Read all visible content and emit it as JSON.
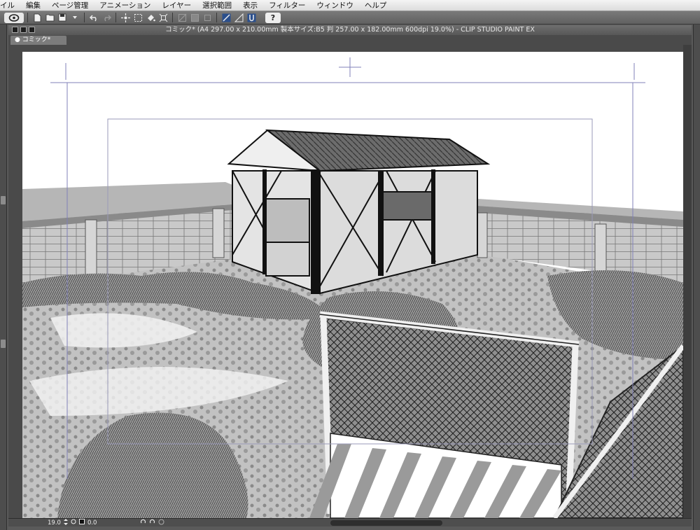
{
  "menu": {
    "items": [
      "イル",
      "編集",
      "ページ管理",
      "アニメーション",
      "レイヤー",
      "選択範囲",
      "表示",
      "フィルター",
      "ウィンドウ",
      "ヘルプ"
    ]
  },
  "toolbar": {
    "icons": [
      "clip-studio-icon",
      "new-file-icon",
      "open-file-icon",
      "save-icon",
      "save-dropdown-icon",
      "undo-icon",
      "redo-icon",
      "transform-icon",
      "selection-icon",
      "fill-icon",
      "expand-icon",
      "layer-icon",
      "mask-icon",
      "outline-icon",
      "ruler-icon",
      "perspective-icon",
      "snap-icon"
    ],
    "help_label": "?"
  },
  "window": {
    "title": "コミック* (A4 297.00 x 210.00mm 製本サイズ:B5 判 257.00 x 182.00mm 600dpi 19.0%)  - CLIP STUDIO PAINT EX",
    "tab_label": "● コミック*"
  },
  "status": {
    "zoom": "19.0",
    "angle": "0.0"
  },
  "colors": {
    "menubar": "#e8e8e8",
    "toolbar": "#6c6c6c",
    "panel": "#4a4a4a",
    "paper": "#ffffff",
    "guide": "#7a7ab4"
  }
}
